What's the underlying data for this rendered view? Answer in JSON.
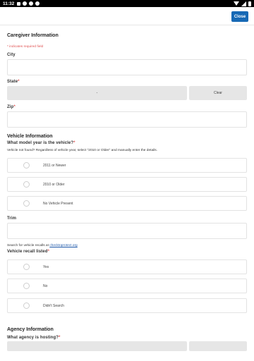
{
  "status_bar": {
    "time": "11:32"
  },
  "header": {
    "close_label": "Close"
  },
  "caregiver": {
    "title": "Caregiver Information",
    "required_note": "* indicates required field",
    "city_label": "City",
    "state_label": "State",
    "state_value": "-",
    "clear_label": "Clear",
    "zip_label": "Zip"
  },
  "vehicle": {
    "title": "Vehicle Information",
    "year_question": "What model year is the vehicle?",
    "year_helper": "Vehicle not found? Regardless of vehicle year, select \"2010 or Older\" and manually enter the details.",
    "year_options": [
      "2011 or Newer",
      "2010 or Older",
      "No Vehicle Present"
    ],
    "trim_label": "Trim",
    "recall_helper_prefix": "Search for vehicle recalls at ",
    "recall_link": "checktoprotect.org",
    "recall_label": "Vehicle recall listed",
    "recall_options": [
      "Yes",
      "No",
      "Didn't Search"
    ]
  },
  "agency": {
    "title": "Agency Information",
    "hosting_question": "What agency is hosting?"
  }
}
